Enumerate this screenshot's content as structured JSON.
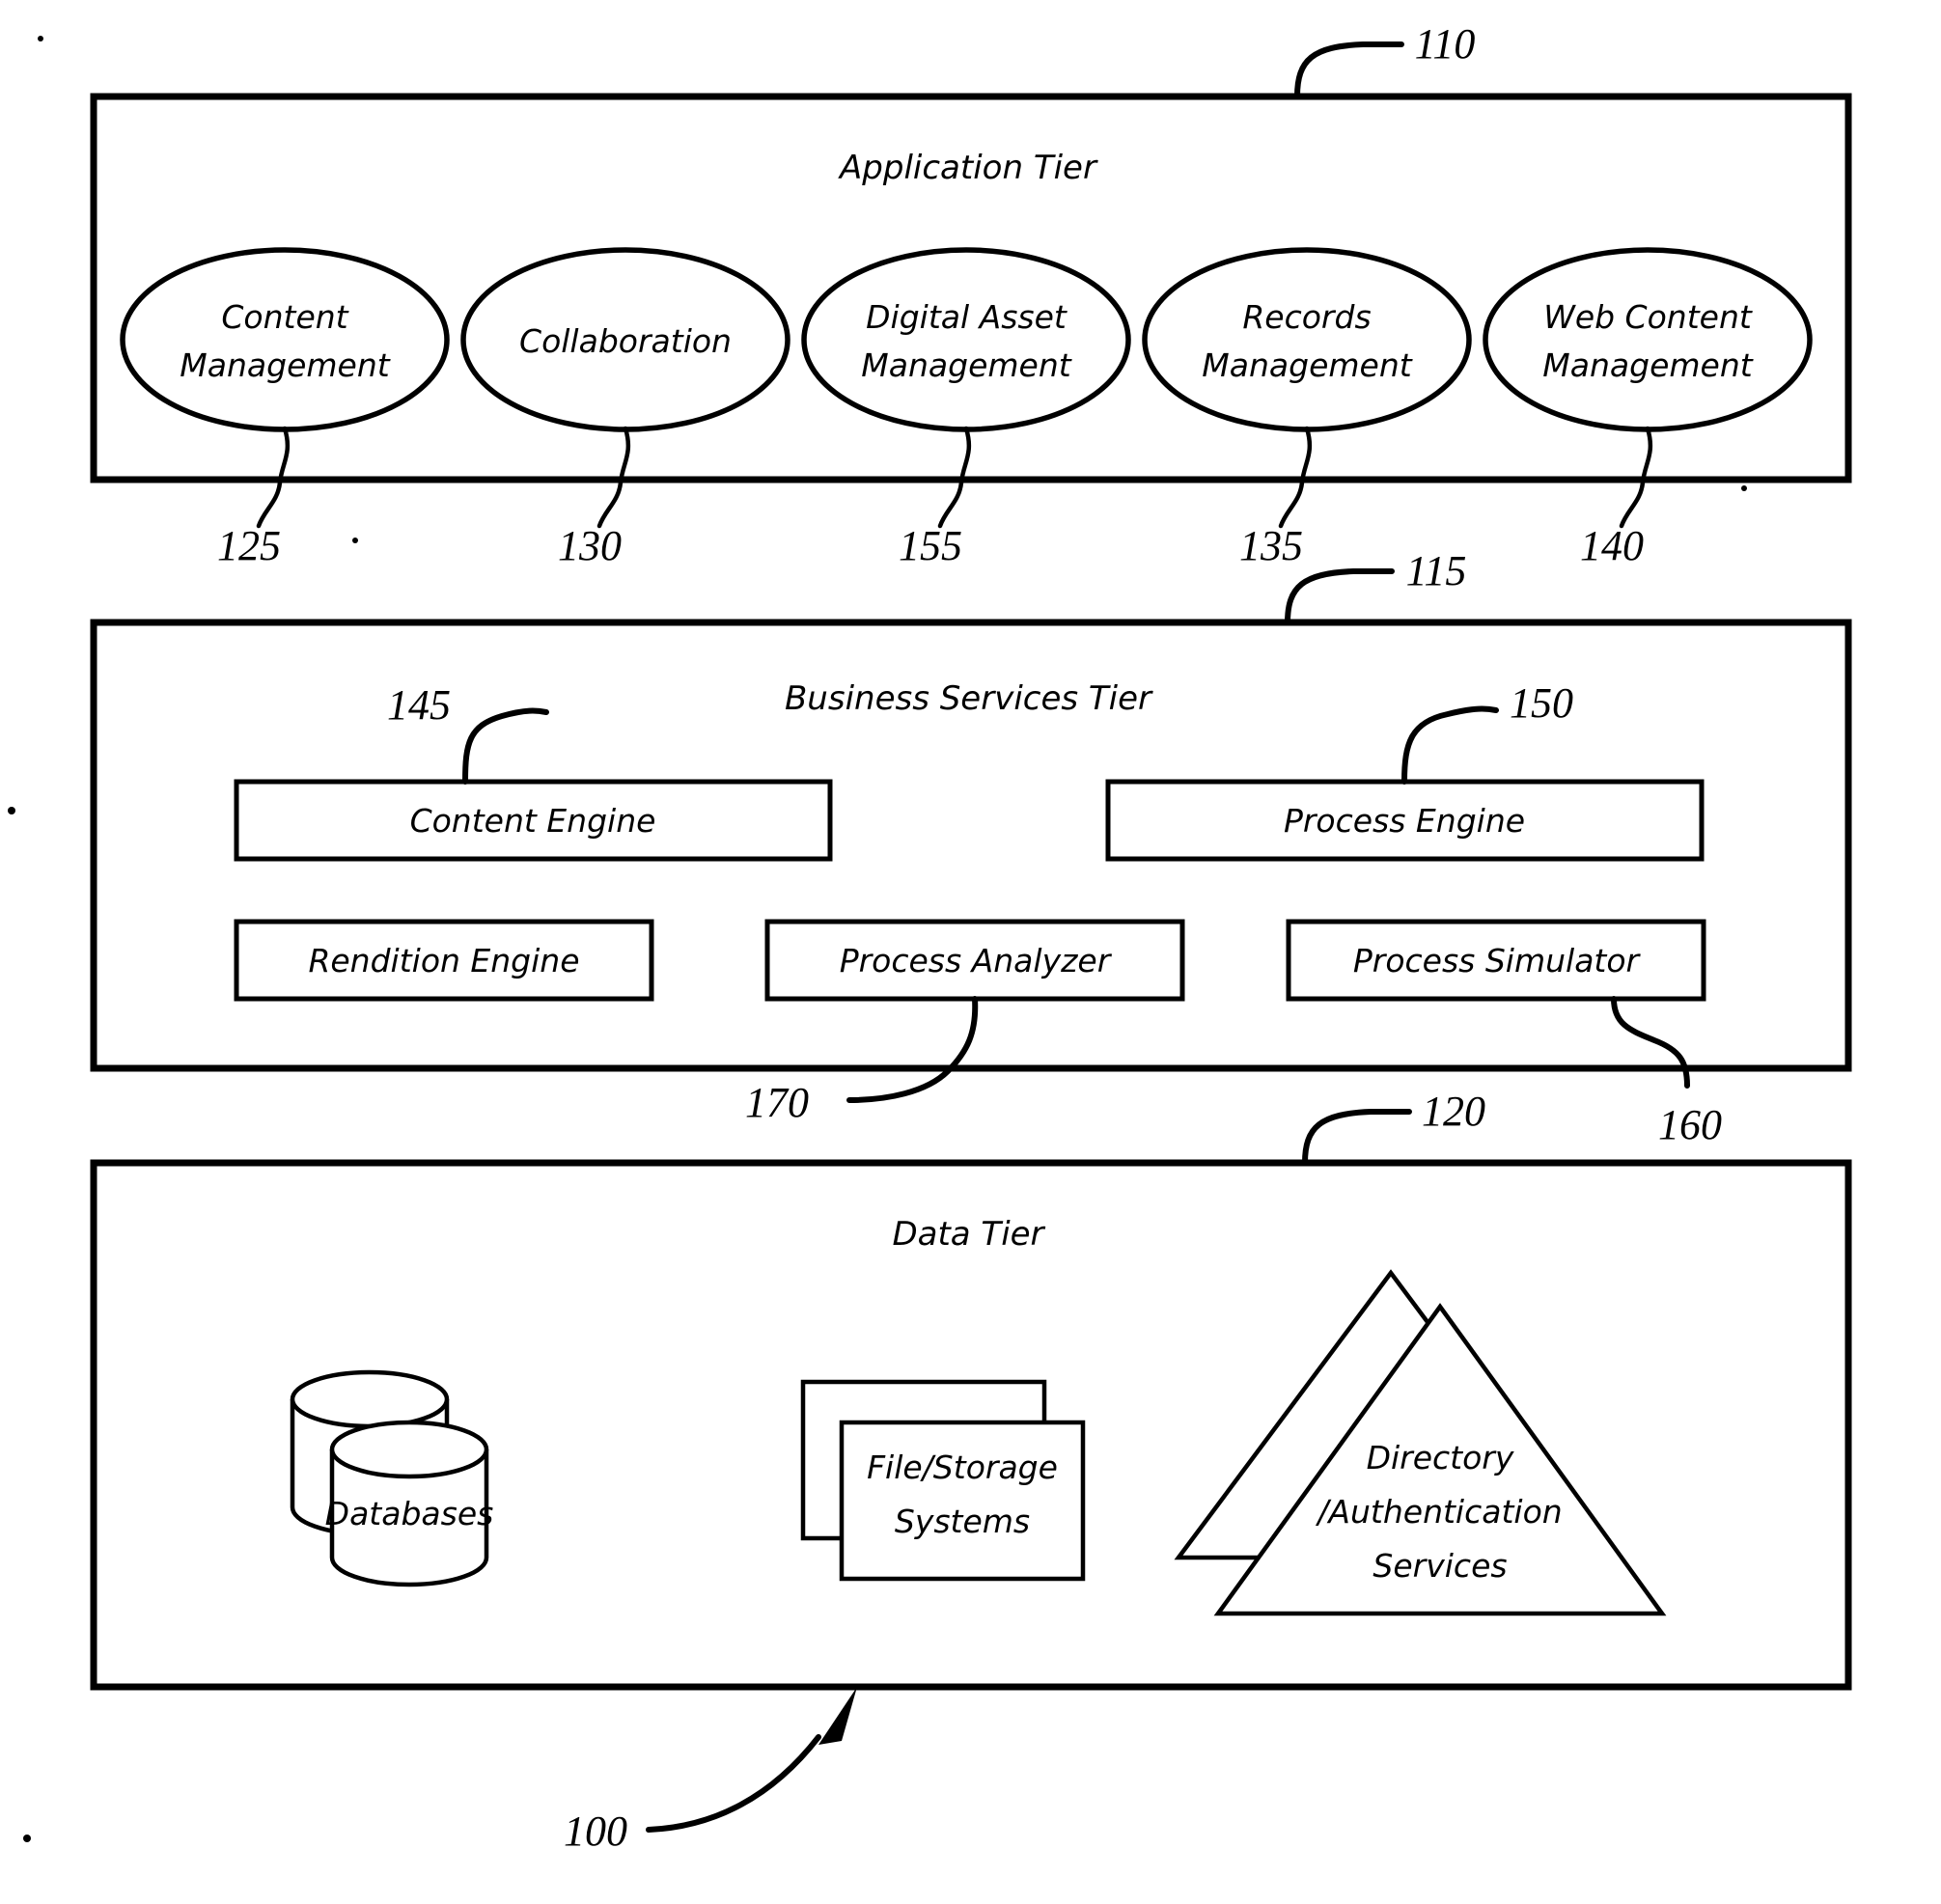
{
  "figure": {
    "kind": "patent-architecture-diagram",
    "overall_reference": "100"
  },
  "tiers": [
    {
      "id": "application-tier",
      "title": "Application Tier",
      "reference": "110",
      "nodes": [
        {
          "label_line1": "Content",
          "label_line2": "Management",
          "reference": "125"
        },
        {
          "label_line1": "Collaboration",
          "label_line2": "",
          "reference": "130"
        },
        {
          "label_line1": "Digital Asset",
          "label_line2": "Management",
          "reference": "155"
        },
        {
          "label_line1": "Records",
          "label_line2": "Management",
          "reference": "135"
        },
        {
          "label_line1": "Web Content",
          "label_line2": "Management",
          "reference": "140"
        }
      ]
    },
    {
      "id": "business-services-tier",
      "title": "Business Services Tier",
      "reference": "115",
      "nodes": [
        {
          "label": "Content Engine",
          "reference": "145"
        },
        {
          "label": "Process Engine",
          "reference": "150"
        },
        {
          "label": "Rendition Engine",
          "reference": ""
        },
        {
          "label": "Process Analyzer",
          "reference": "170"
        },
        {
          "label": "Process Simulator",
          "reference": "160"
        }
      ]
    },
    {
      "id": "data-tier",
      "title": "Data Tier",
      "reference": "120",
      "nodes": [
        {
          "label_line1": "Databases",
          "label_line2": "",
          "label_line3": "",
          "shape": "cylinder-stack"
        },
        {
          "label_line1": "File/Storage",
          "label_line2": "Systems",
          "label_line3": "",
          "shape": "document-stack"
        },
        {
          "label_line1": "Directory",
          "label_line2": "/Authentication",
          "label_line3": "Services",
          "shape": "triangle-stack"
        }
      ]
    }
  ],
  "colors": {
    "ink": "#000000",
    "paper": "#ffffff"
  }
}
